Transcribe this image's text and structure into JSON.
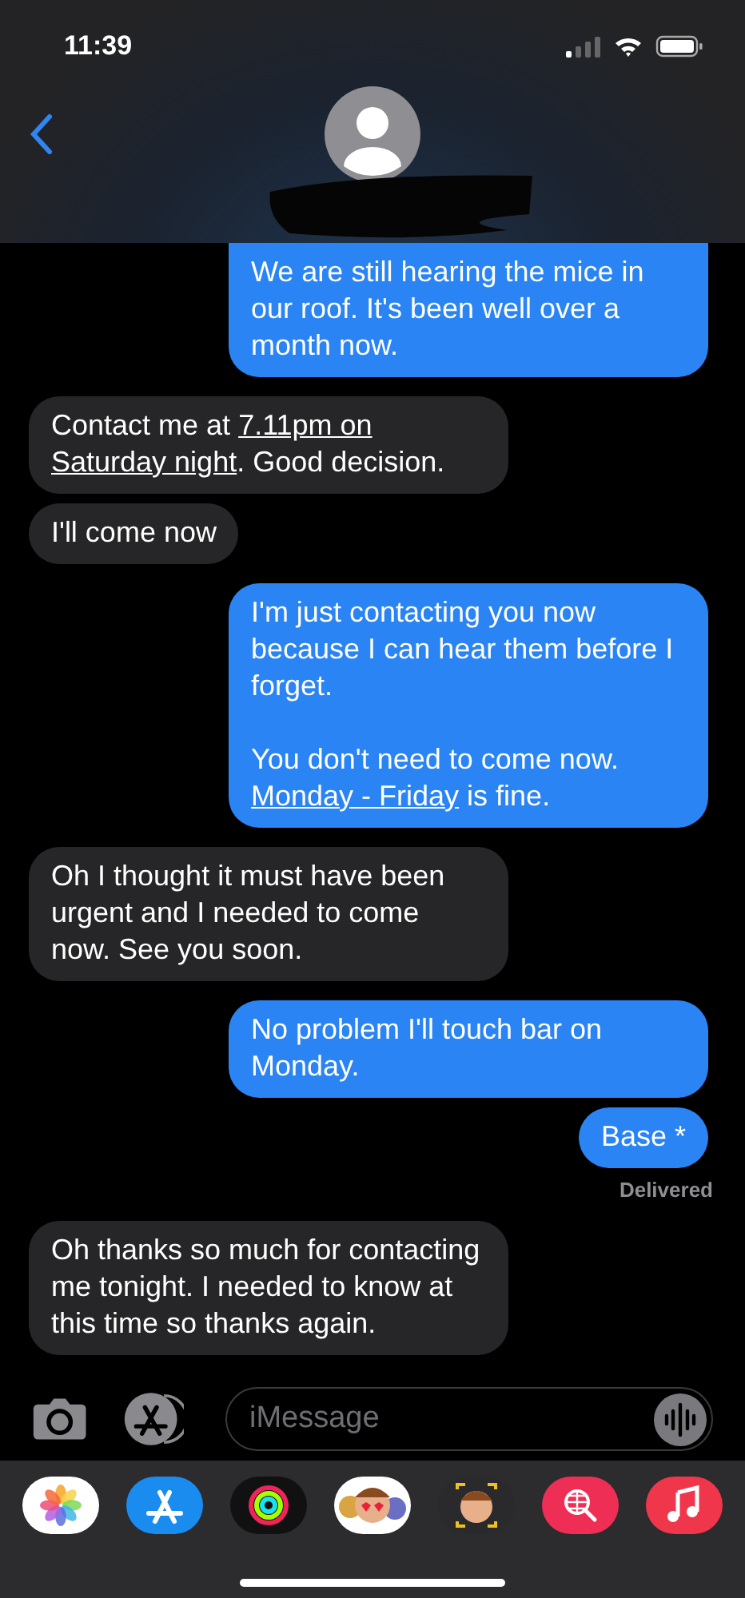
{
  "status_bar": {
    "time": "11:39"
  },
  "messages": [
    {
      "outgoing": true,
      "paragraphs": [
        [
          {
            "text": "We are still hearing the mice in our roof. It's been well over a month now.",
            "link": false
          }
        ]
      ]
    },
    {
      "outgoing": false,
      "paragraphs": [
        [
          {
            "text": "Contact me at ",
            "link": false
          },
          {
            "text": "7.11pm on",
            "link": true
          },
          {
            "text": "Saturday night",
            "link": true
          },
          {
            "text": ". Good decision.",
            "link": false
          }
        ]
      ]
    },
    {
      "outgoing": false,
      "paragraphs": [
        [
          {
            "text": "I'll come now",
            "link": false
          }
        ]
      ]
    },
    {
      "outgoing": true,
      "paragraphs": [
        [
          {
            "text": "I'm just contacting you now because I can hear them before I forget.",
            "link": false
          }
        ],
        [
          {
            "text": "You don't need to come now. ",
            "link": false
          },
          {
            "text": "Monday - Friday",
            "link": true
          },
          {
            "text": " is fine.",
            "link": false
          }
        ]
      ]
    },
    {
      "outgoing": false,
      "paragraphs": [
        [
          {
            "text": "Oh I thought it must have been urgent and I needed to come now. See you soon.",
            "link": false
          }
        ]
      ]
    },
    {
      "outgoing": true,
      "paragraphs": [
        [
          {
            "text": "No problem I'll touch bar on Monday.",
            "link": false
          }
        ]
      ]
    },
    {
      "outgoing": true,
      "paragraphs": [
        [
          {
            "text": "Base *",
            "link": false
          }
        ]
      ],
      "status": "Delivered"
    },
    {
      "outgoing": false,
      "paragraphs": [
        [
          {
            "text": "Oh thanks so much for contacting me tonight. I needed to know at this time so thanks again.",
            "link": false
          }
        ]
      ]
    }
  ],
  "compose": {
    "placeholder": "iMessage"
  }
}
